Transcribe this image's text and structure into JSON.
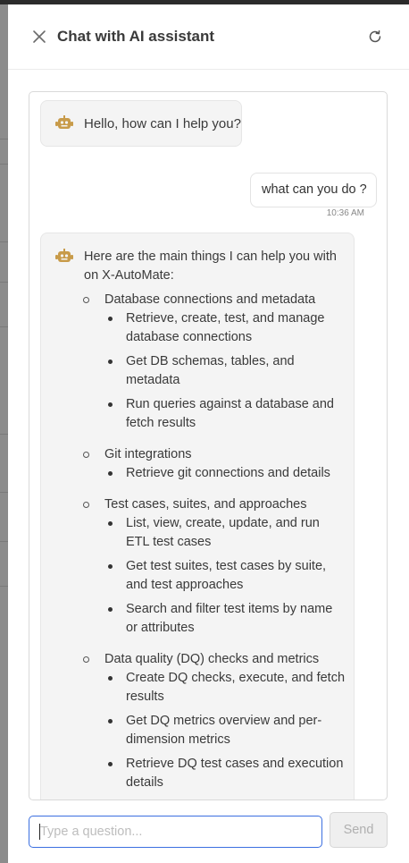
{
  "header": {
    "title": "Chat with AI assistant"
  },
  "icons": {
    "close": "close-icon",
    "refresh": "refresh-icon",
    "bot": "robot-icon"
  },
  "messages": {
    "greeting": "Hello, how can I help you?",
    "user": {
      "text": "what can you do ?",
      "time": "10:36 AM"
    },
    "reply": {
      "intro": "Here are the main things I can help you with on X-AutoMate:",
      "sections": [
        {
          "title": "Database connections and metadata",
          "items": [
            "Retrieve, create, test, and manage database connections",
            "Get DB schemas, tables, and metadata",
            "Run queries against a database and fetch results"
          ]
        },
        {
          "title": "Git integrations",
          "items": [
            "Retrieve git connections and details"
          ]
        },
        {
          "title": "Test cases, suites, and approaches",
          "items": [
            "List, view, create, update, and run ETL test cases",
            "Get test suites, test cases by suite, and test approaches",
            "Search and filter test items by name or attributes"
          ]
        },
        {
          "title": "Data quality (DQ) checks and metrics",
          "items": [
            "Create DQ checks, execute, and fetch results",
            "Get DQ metrics overview and per-dimension metrics",
            "Retrieve DQ test cases and execution details"
          ]
        }
      ]
    }
  },
  "composer": {
    "placeholder": "Type a question...",
    "send_label": "Send"
  },
  "colors": {
    "accent": "#3b6fe0",
    "bot_icon": "#c89b4a"
  }
}
